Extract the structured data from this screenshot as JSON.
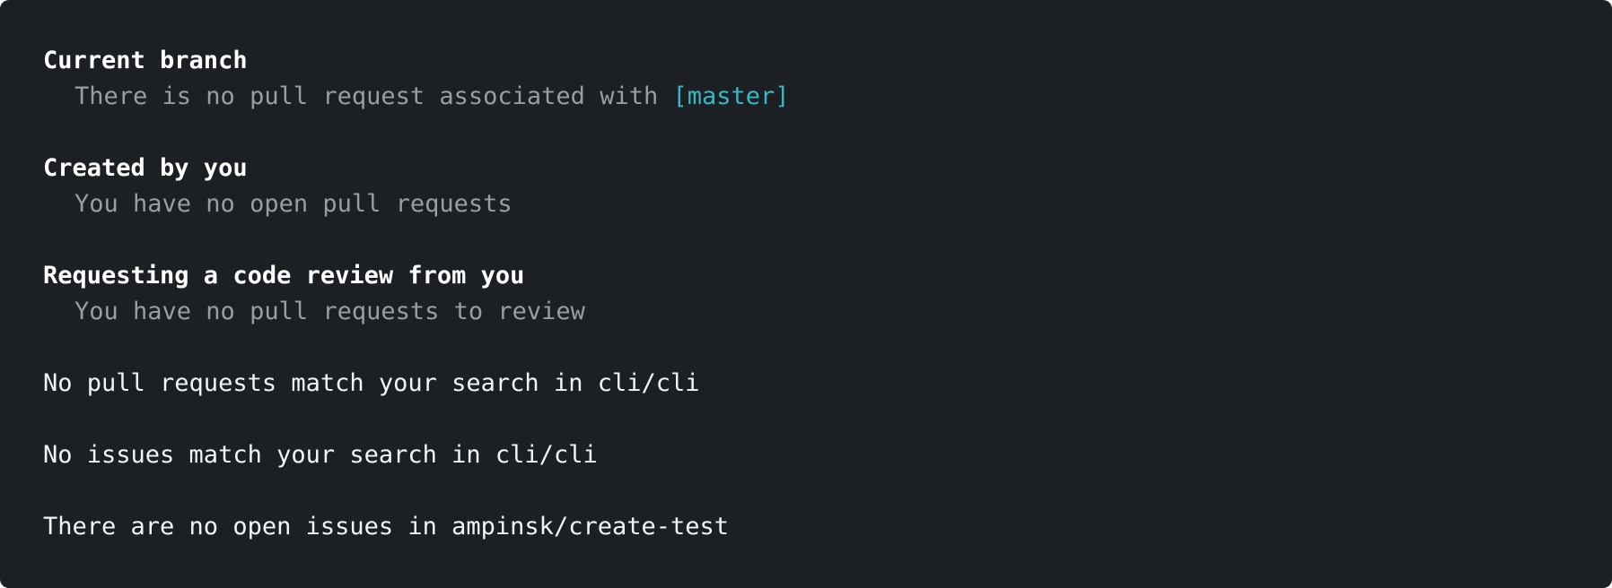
{
  "sections": {
    "current_branch": {
      "heading": "Current branch",
      "message": "There is no pull request associated with ",
      "branch": "[master]"
    },
    "created_by_you": {
      "heading": "Created by you",
      "message": "You have no open pull requests"
    },
    "review_requests": {
      "heading": "Requesting a code review from you",
      "message": "You have no pull requests to review"
    }
  },
  "messages": {
    "no_prs_match": "No pull requests match your search in cli/cli",
    "no_issues_match": "No issues match your search in cli/cli",
    "no_open_issues": "There are no open issues in ampinsk/create-test"
  },
  "colors": {
    "background": "#1c1f23",
    "heading": "#ffffff",
    "muted_text": "#9a9ea4",
    "branch_accent": "#39b8c4",
    "plain_text": "#f2f4f6"
  }
}
